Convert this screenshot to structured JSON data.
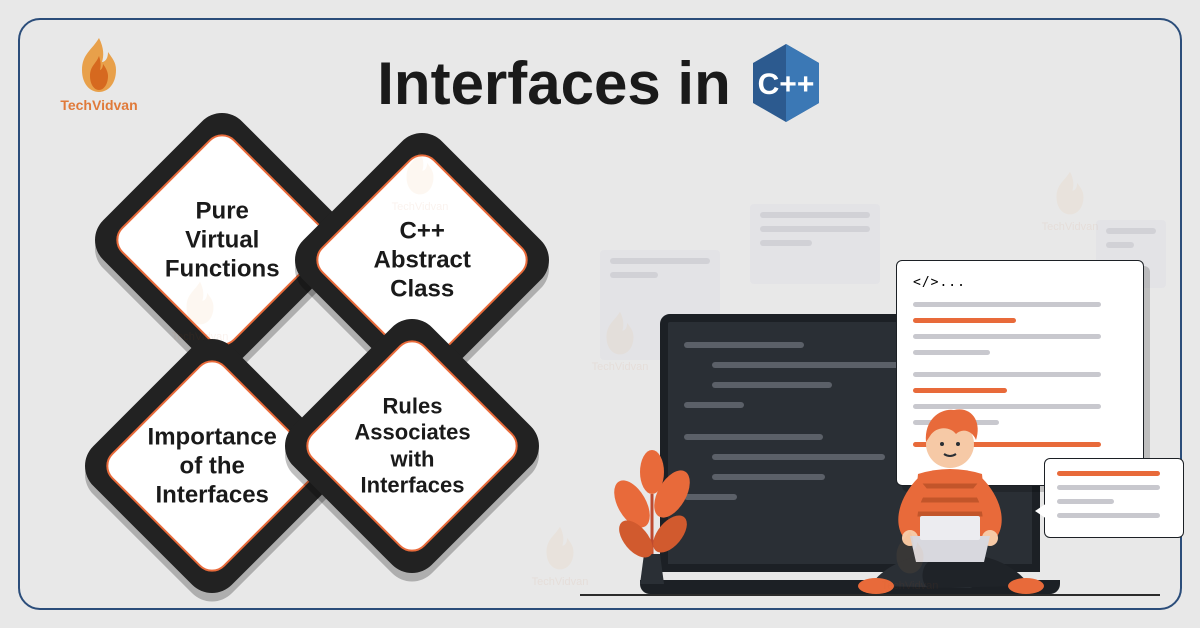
{
  "brand": "TechVidvan",
  "title": "Interfaces in",
  "badge": {
    "language": "C++"
  },
  "tiles": [
    {
      "label": "Pure\nVirtual\nFunctions"
    },
    {
      "label": "C++\nAbstract\nClass"
    },
    {
      "label": "Importance\nof the\nInterfaces"
    },
    {
      "label": "Rules\nAssociates\nwith\nInterfaces"
    }
  ],
  "editor": {
    "head": "</>..."
  },
  "colors": {
    "frame_border": "#2b4d7a",
    "accent_orange": "#e86a3a",
    "tile_bg": "#222",
    "laptop_dark": "#2a2f35"
  }
}
